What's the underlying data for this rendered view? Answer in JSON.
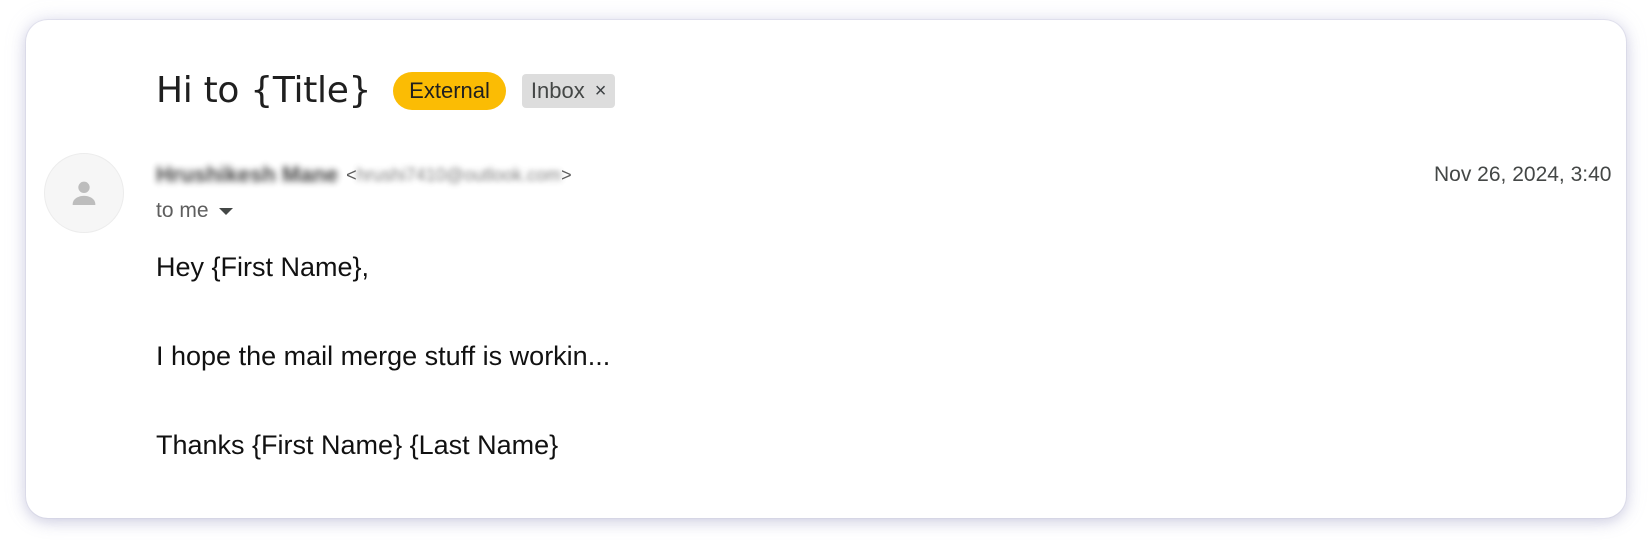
{
  "email": {
    "subject": "Hi to {Title}",
    "labels": {
      "external": "External",
      "inbox": "Inbox",
      "inbox_remove": "×"
    },
    "sender": {
      "name": "Hrushikesh Mane",
      "email_open": "<",
      "email": "hrushi7410@outlook.com",
      "email_close": ">",
      "avatar_icon": "person-icon"
    },
    "date": "Nov 26, 2024, 3:40",
    "recipient": "to me",
    "body": {
      "greeting": "Hey {First Name},",
      "paragraph": "I hope the mail merge stuff is workin...",
      "signoff": "Thanks {First Name} {Last Name}"
    }
  },
  "colors": {
    "external_label": "#fbbc04",
    "inbox_label": "#dddddd",
    "text_primary": "#1f1f1f",
    "text_secondary": "#5e5e5e"
  }
}
